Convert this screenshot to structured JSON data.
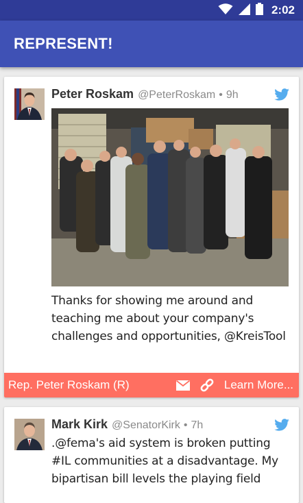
{
  "status_bar": {
    "time": "2:02"
  },
  "app_bar": {
    "title": "REPRESENT!"
  },
  "tweets": [
    {
      "name": "Peter Roskam",
      "handle": "@PeterRoskam",
      "separator": "•",
      "time": "9h",
      "text": "Thanks for showing me around and teaching me about your company's challenges and opportunities, @KreisTool",
      "rep_bar": {
        "name": "Rep. Peter Roskam (R)",
        "learn_more": "Learn More..."
      }
    },
    {
      "name": "Mark Kirk",
      "handle": "@SenatorKirk",
      "separator": "•",
      "time": "7h",
      "text": ".@fema's aid system is broken putting #IL communities at a disadvantage. My bipartisan bill levels the playing field"
    }
  ],
  "colors": {
    "status_bar": "#2f3b97",
    "app_bar": "#3f51b5",
    "rep_bar": "#ff6f61",
    "twitter_blue": "#55acee"
  },
  "icons": [
    "wifi-icon",
    "signal-icon",
    "battery-icon",
    "twitter-bird-icon",
    "mail-icon",
    "link-icon"
  ]
}
